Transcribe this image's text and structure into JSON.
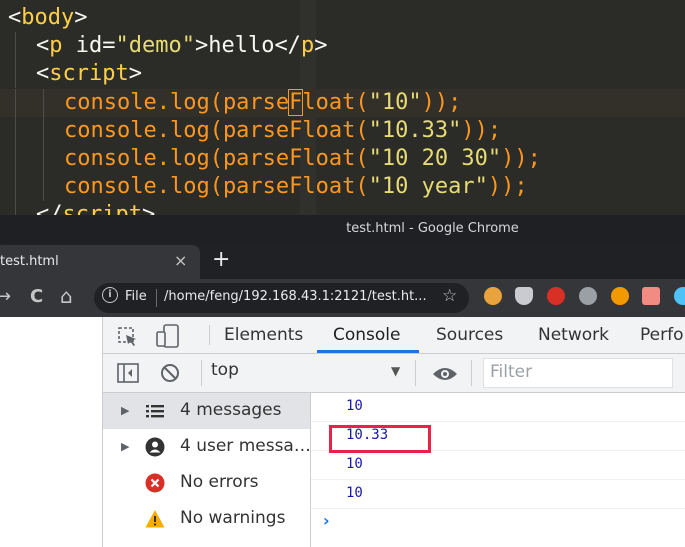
{
  "editor": {
    "lines": [
      {
        "indent": 0,
        "tokens": [
          [
            "pun",
            "<"
          ],
          [
            "tag",
            "body"
          ],
          [
            "pun",
            ">"
          ]
        ]
      },
      {
        "indent": 1,
        "tokens": [
          [
            "pun",
            "<"
          ],
          [
            "tag",
            "p"
          ],
          [
            "attr",
            " id="
          ],
          [
            "str",
            "\"demo\""
          ],
          [
            "pun",
            ">hello</"
          ],
          [
            "tag",
            "p"
          ],
          [
            "pun",
            ">"
          ]
        ]
      },
      {
        "indent": 1,
        "tokens": [
          [
            "pun",
            "<"
          ],
          [
            "tag",
            "script"
          ],
          [
            "pun",
            ">"
          ]
        ]
      },
      {
        "indent": 2,
        "tokens": [
          [
            "fn",
            "console.log(parse"
          ],
          [
            "cur",
            "F"
          ],
          [
            "fn",
            "loat("
          ],
          [
            "str",
            "\"10\""
          ],
          [
            "fn",
            "));"
          ]
        ]
      },
      {
        "indent": 2,
        "tokens": [
          [
            "fn",
            "console.log(parseFloat("
          ],
          [
            "str",
            "\"10.33\""
          ],
          [
            "fn",
            "));"
          ]
        ]
      },
      {
        "indent": 2,
        "tokens": [
          [
            "fn",
            "console.log(parseFloat("
          ],
          [
            "str",
            "\"10 20 30\""
          ],
          [
            "fn",
            "));"
          ]
        ]
      },
      {
        "indent": 2,
        "tokens": [
          [
            "fn",
            "console.log(parseFloat("
          ],
          [
            "str",
            "\"10 year\""
          ],
          [
            "fn",
            "));"
          ]
        ]
      },
      {
        "indent": 1,
        "tokens": [
          [
            "pun",
            "</"
          ],
          [
            "tag",
            "script"
          ],
          [
            "pun",
            ">"
          ]
        ]
      }
    ]
  },
  "window": {
    "title": "test.html - Google Chrome",
    "tab_title": "test.html",
    "tab_close": "×",
    "new_tab": "+",
    "nav": {
      "back": "→",
      "reload": "C",
      "home": "⌂"
    },
    "omnibox": {
      "scheme_label": "File",
      "url": "/home/feng/192.168.43.1:2121/test.ht..."
    },
    "bookmark_star": "☆"
  },
  "devtools": {
    "tabs": [
      "Elements",
      "Console",
      "Sources",
      "Network",
      "Perfor"
    ],
    "active_tab": "Console",
    "context": "top",
    "filter_placeholder": "Filter",
    "sidebar": [
      {
        "label": "4 messages",
        "icon": "list-icon",
        "arrow": "▶",
        "selected": true
      },
      {
        "label": "4 user messa…",
        "icon": "user-icon",
        "arrow": "▶",
        "selected": false
      },
      {
        "label": "No errors",
        "icon": "error-icon",
        "arrow": "",
        "selected": false
      },
      {
        "label": "No warnings",
        "icon": "warning-icon",
        "arrow": "",
        "selected": false
      }
    ],
    "logs": [
      "10",
      "10.33",
      "10",
      "10"
    ],
    "prompt": "›"
  },
  "colors": {
    "editor_bg": "#2b2b28",
    "tag": "#ffcf4a",
    "string": "#e6db74",
    "function": "#fd971f",
    "accent": "#1a73e8",
    "highlight": "#e8234a"
  }
}
